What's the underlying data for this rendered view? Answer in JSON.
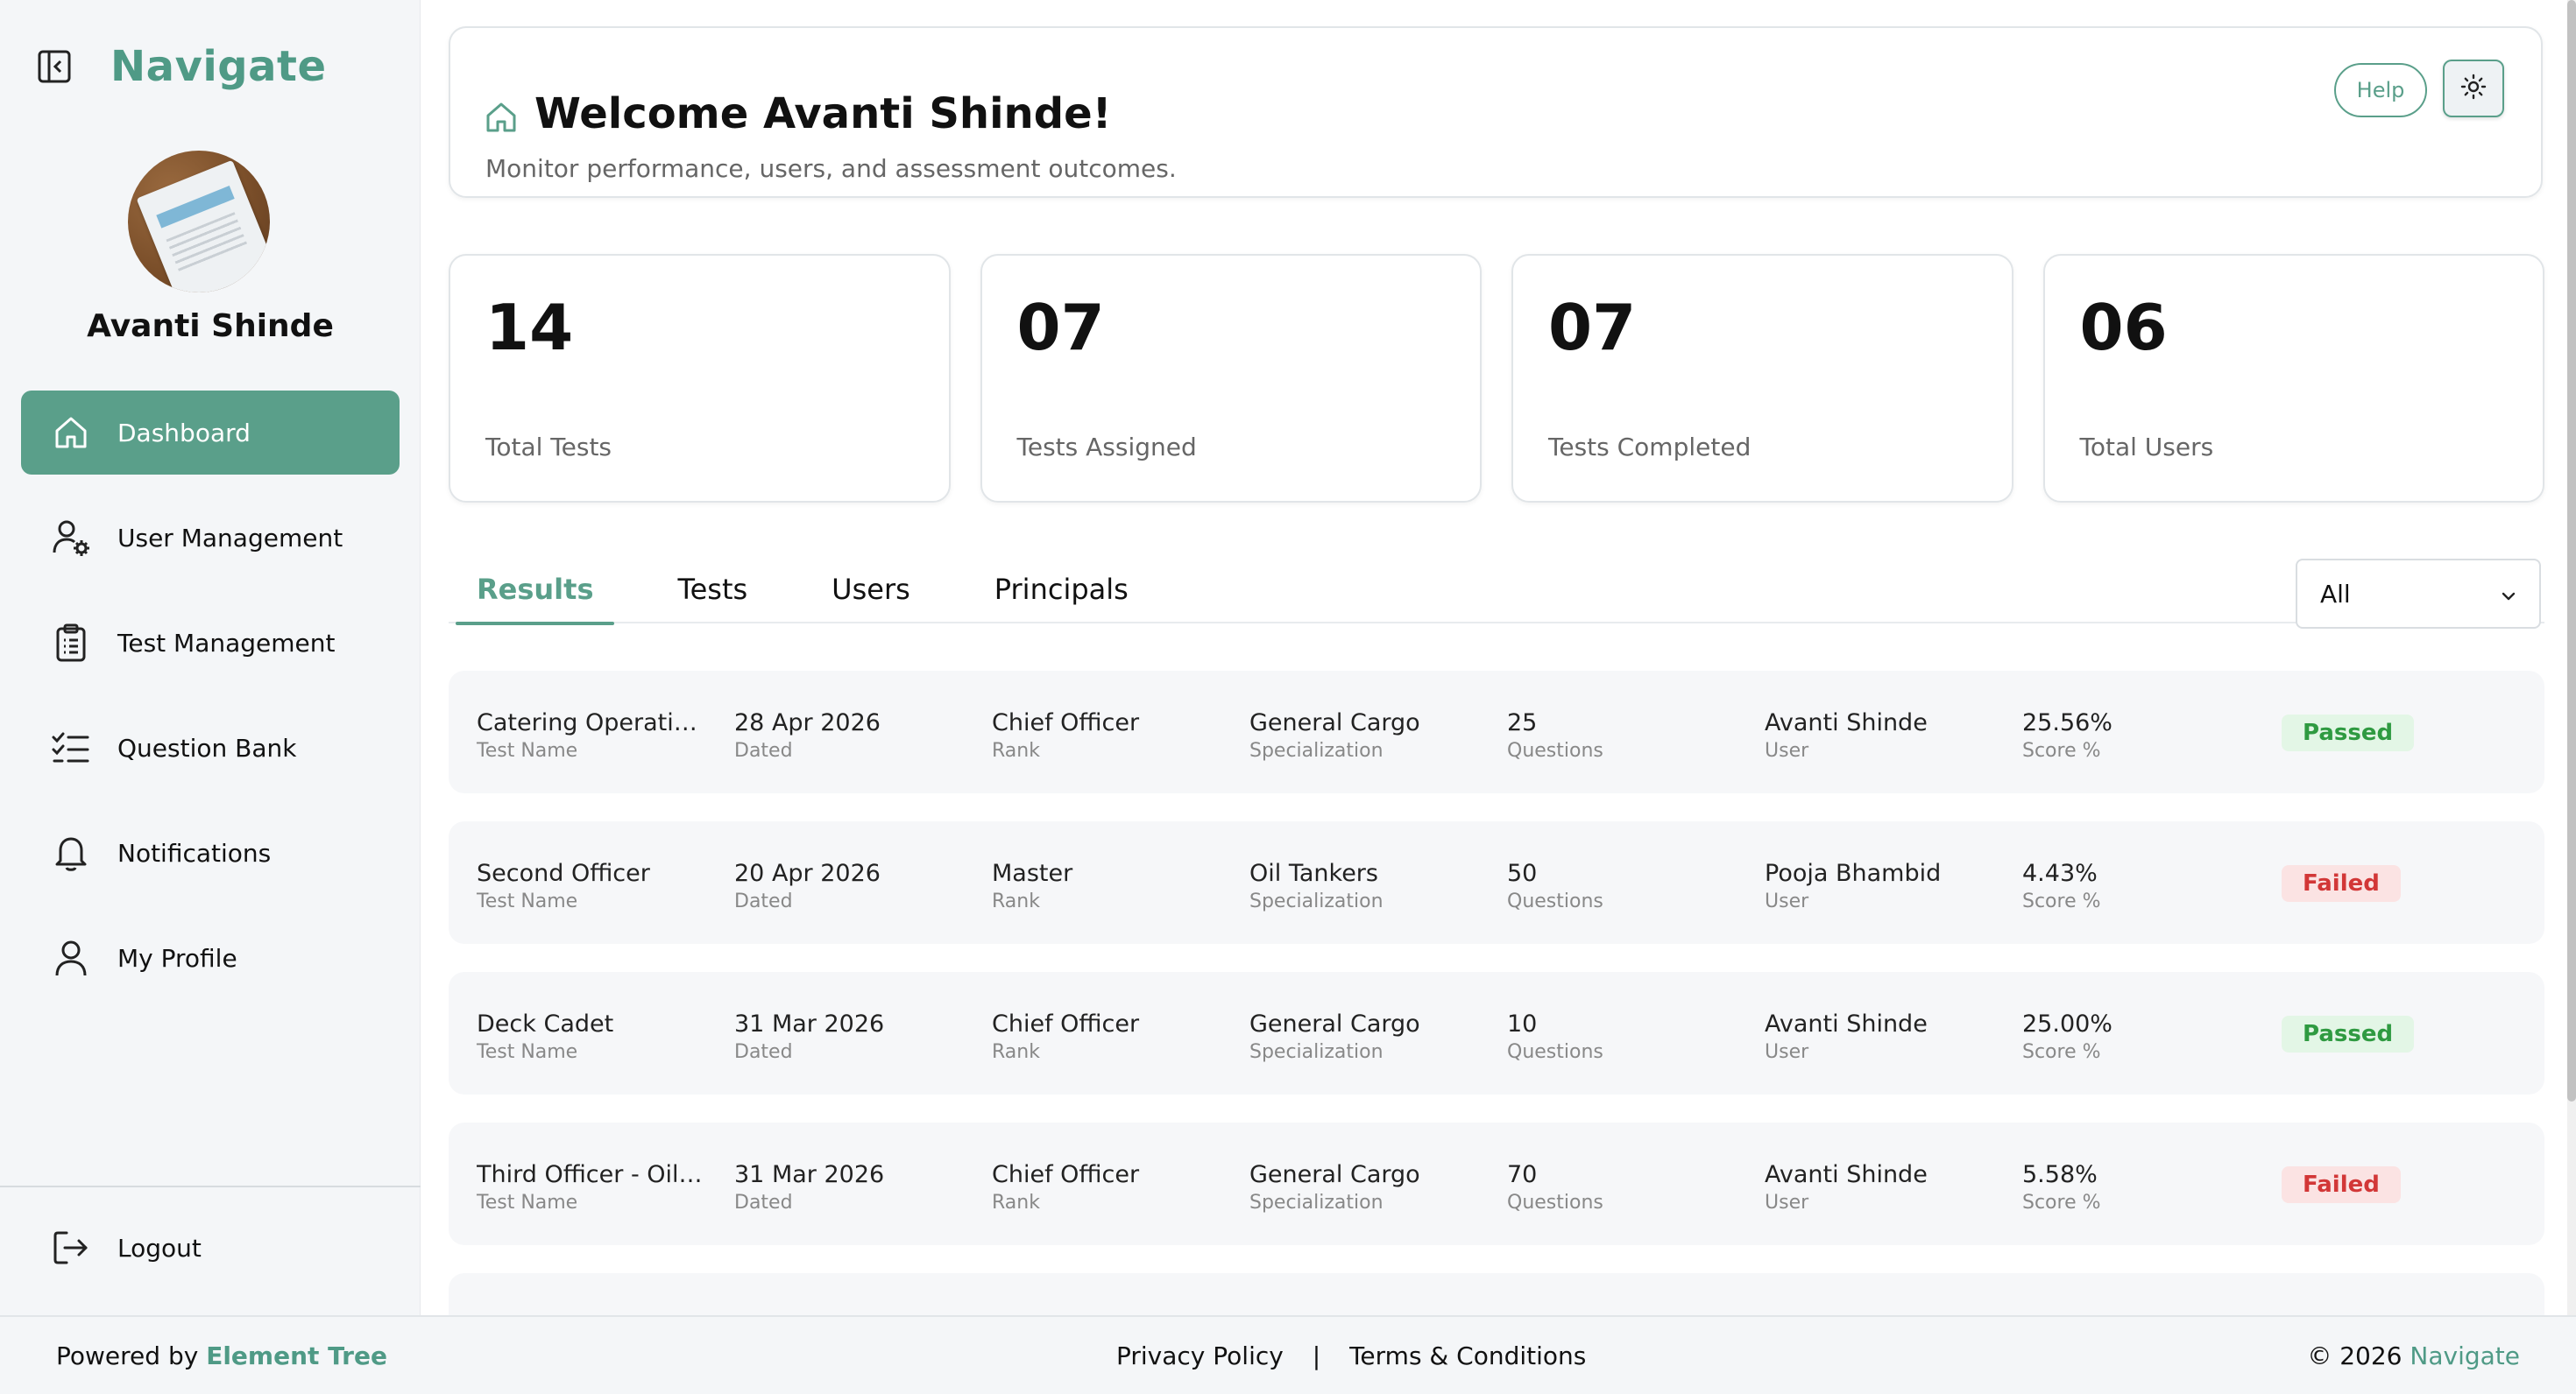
{
  "brand": {
    "name": "Navigate",
    "accent": "#5a9f8a"
  },
  "user": {
    "name": "Avanti Shinde"
  },
  "sidebar": {
    "items": [
      {
        "label": "Dashboard",
        "icon": "home-icon"
      },
      {
        "label": "User Management",
        "icon": "user-gear-icon"
      },
      {
        "label": "Test Management",
        "icon": "clipboard-icon"
      },
      {
        "label": "Question Bank",
        "icon": "checklist-icon"
      },
      {
        "label": "Notifications",
        "icon": "bell-icon"
      },
      {
        "label": "My Profile",
        "icon": "user-icon"
      }
    ],
    "active": "Dashboard",
    "logout_label": "Logout"
  },
  "header": {
    "title": "Welcome Avanti Shinde!",
    "subtitle": "Monitor performance, users, and assessment outcomes.",
    "help_label": "Help",
    "theme_icon": "sun-icon"
  },
  "stats": [
    {
      "value": "14",
      "label": "Total Tests"
    },
    {
      "value": "07",
      "label": "Tests Assigned"
    },
    {
      "value": "07",
      "label": "Tests Completed"
    },
    {
      "value": "06",
      "label": "Total Users"
    }
  ],
  "tabs": [
    "Results",
    "Tests",
    "Users",
    "Principals"
  ],
  "active_tab": "Results",
  "filter": {
    "selected": "All"
  },
  "result_fields": [
    "Test Name",
    "Dated",
    "Rank",
    "Specialization",
    "Questions",
    "User",
    "Score %"
  ],
  "results": [
    {
      "test_name": "Catering Operatio...",
      "dated": "28 Apr 2026",
      "rank": "Chief Officer",
      "specialization": "General Cargo",
      "questions": "25",
      "user": "Avanti Shinde",
      "score": "25.56%",
      "status": "Passed"
    },
    {
      "test_name": "Second Officer",
      "dated": "20 Apr 2026",
      "rank": "Master",
      "specialization": "Oil Tankers",
      "questions": "50",
      "user": "Pooja Bhambid",
      "score": "4.43%",
      "status": "Failed"
    },
    {
      "test_name": "Deck Cadet",
      "dated": "31 Mar 2026",
      "rank": "Chief Officer",
      "specialization": "General Cargo",
      "questions": "10",
      "user": "Avanti Shinde",
      "score": "25.00%",
      "status": "Passed"
    },
    {
      "test_name": "Third Officer - Oil T...",
      "dated": "31 Mar 2026",
      "rank": "Chief Officer",
      "specialization": "General Cargo",
      "questions": "70",
      "user": "Avanti Shinde",
      "score": "5.58%",
      "status": "Failed"
    }
  ],
  "footer": {
    "powered_prefix": "Powered by",
    "powered_brand": "Element Tree",
    "privacy": "Privacy Policy",
    "separator": "|",
    "terms": "Terms & Conditions",
    "copyright_prefix": "© 2026",
    "copyright_brand": "Navigate"
  }
}
